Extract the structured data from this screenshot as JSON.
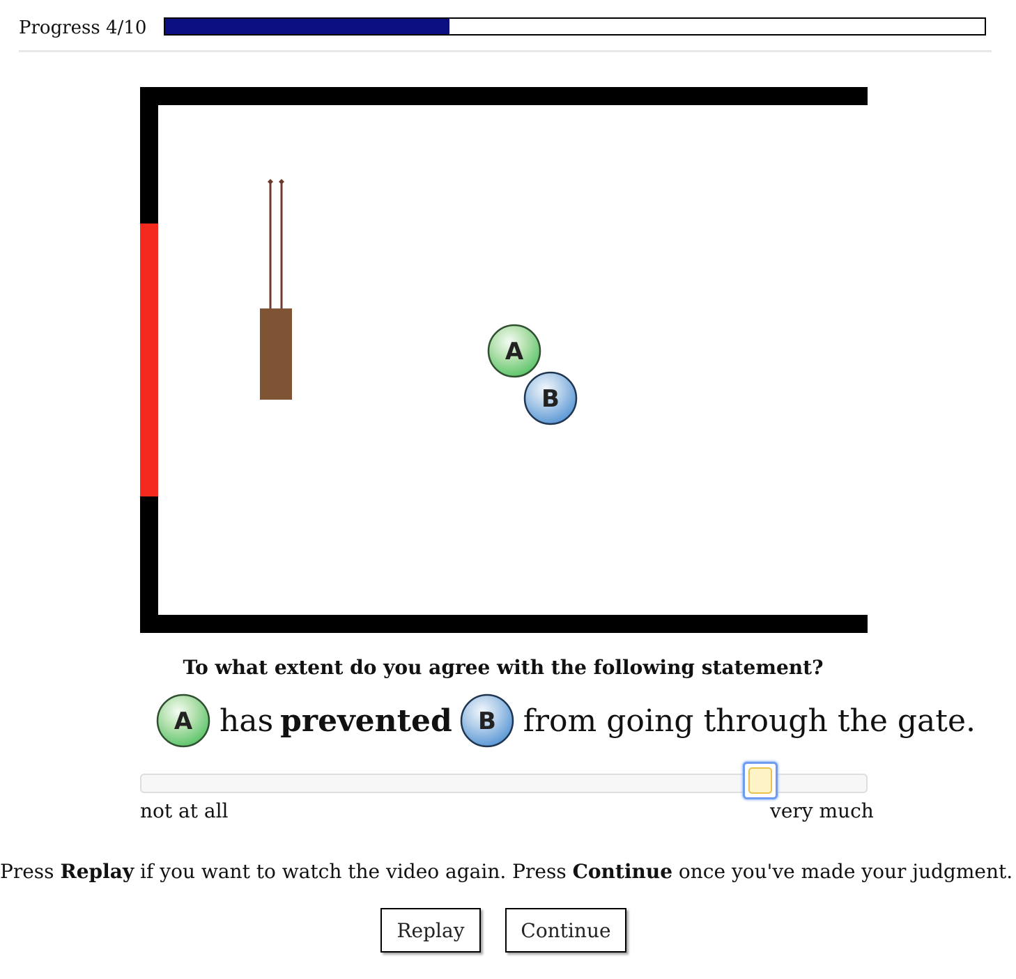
{
  "progress": {
    "label": "Progress 4/10",
    "fraction": 0.347,
    "fill_color": "#0b0f82"
  },
  "scene": {
    "wall_color": "#000000",
    "gate_color": "#f52a1e",
    "block_color": "#7f5434",
    "ball_a": {
      "label": "A",
      "color": "#5cc46a"
    },
    "ball_b": {
      "label": "B",
      "color": "#5a97d6"
    }
  },
  "question": {
    "prompt": "To what extent do you agree with the following statement?",
    "agent_label": "A",
    "word_has": "has",
    "verb": "prevented",
    "patient_label": "B",
    "rest": "from going through the gate."
  },
  "slider": {
    "value": 0.87,
    "min_label": "not at all",
    "max_label": "very much"
  },
  "instructions": {
    "t1": "Press ",
    "b1": "Replay",
    "t2": " if you want to watch the video again. Press ",
    "b2": "Continue",
    "t3": " once you've made your judgment."
  },
  "buttons": {
    "replay": "Replay",
    "continue": "Continue"
  }
}
